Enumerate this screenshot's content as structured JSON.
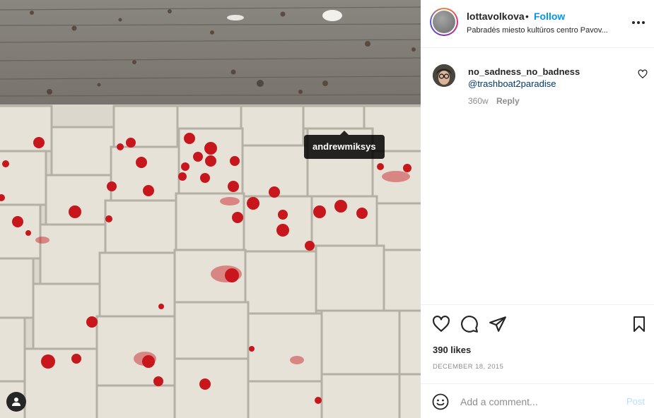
{
  "photo": {
    "tag_username": "andrewmiksys",
    "tag_button_icon": "user-icon"
  },
  "header": {
    "username": "lottavolkova",
    "separator": "•",
    "follow_label": "Follow",
    "location": "Pabradės miesto kultūros centro Pavov...",
    "more_icon": "more-options-icon"
  },
  "comment": {
    "username": "no_sadness_no_badness",
    "text": "@trashboat2paradise",
    "time": "360w",
    "reply_label": "Reply"
  },
  "actions": {
    "like_icon": "heart-icon",
    "comment_icon": "comment-icon",
    "share_icon": "send-icon",
    "save_icon": "bookmark-icon"
  },
  "likes": "390 likes",
  "date": "DECEMBER 18, 2015",
  "comment_bar": {
    "emoji_icon": "emoji-icon",
    "placeholder": "Add a comment...",
    "post_label": "Post"
  },
  "colors": {
    "follow": "#0095f6",
    "mention": "#00376b",
    "muted": "#8e8e8e",
    "post_disabled": "#b2dffc",
    "blood": "#c8161d"
  }
}
